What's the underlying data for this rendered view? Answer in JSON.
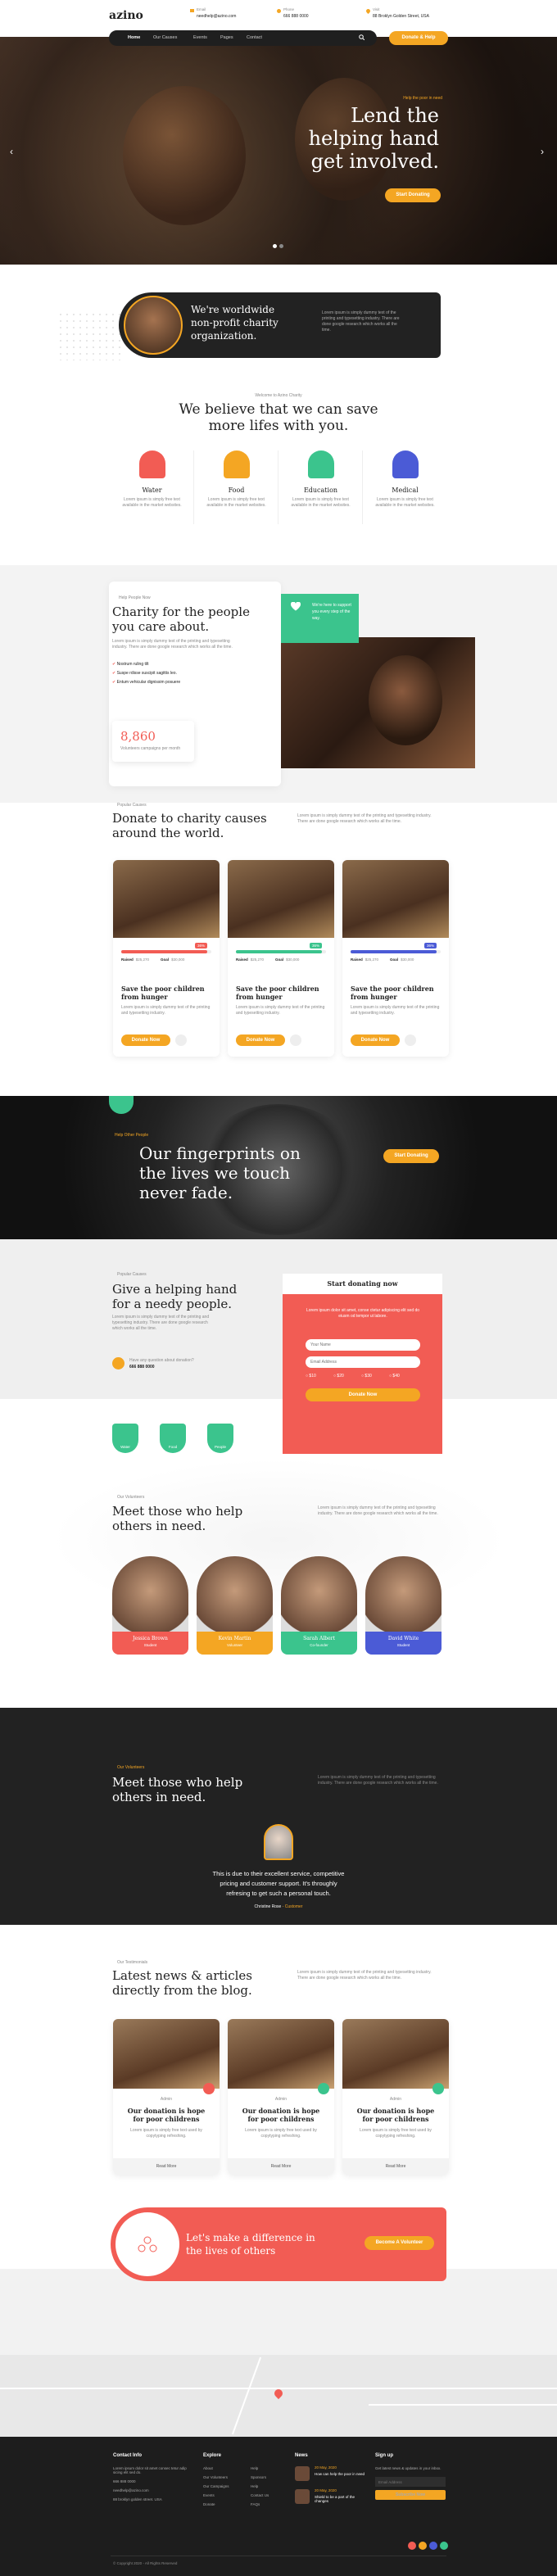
{
  "brand": {
    "logo": "azino"
  },
  "contact": {
    "email_label": "Email",
    "email": "needhelp@azino.com",
    "phone_label": "Phone",
    "phone": "666 888 0000",
    "visit_label": "Visit",
    "address": "88 Broklyn Golden Street, USA"
  },
  "nav": {
    "items": [
      "Home",
      "Our Causes",
      "Events",
      "Pages",
      "Contact"
    ],
    "cta": "Donate & Help"
  },
  "hero": {
    "tagline": "Help the poor in need",
    "title_lines": [
      "Lend the",
      "helping hand",
      "get involved."
    ],
    "button": "Start Donating"
  },
  "intro": {
    "title_lines": [
      "We're worldwide",
      "non-profit charity",
      "organization."
    ],
    "text": "Lorem ipsum is simply dummy text of the printing and typesetting industry. There are done google research which works all the time."
  },
  "welcome": {
    "tagline": "Welcome to Azino Charity",
    "title_lines": [
      "We believe that we can save",
      "more lifes with you."
    ],
    "features": [
      {
        "name": "Water",
        "text": "Lorem ipsum is simply free text available in the market websites.",
        "color": "#f25c54"
      },
      {
        "name": "Food",
        "text": "Lorem ipsum is simply free text available in the market websites.",
        "color": "#f4a623"
      },
      {
        "name": "Education",
        "text": "Lorem ipsum is simply free text available in the market websites.",
        "color": "#3bc48d"
      },
      {
        "name": "Medical",
        "text": "Lorem ipsum is simply free text available in the market websites.",
        "color": "#4b5bd6"
      }
    ]
  },
  "charity": {
    "tagline": "Help People Now",
    "title_lines": [
      "Charity for the people",
      "you care about."
    ],
    "text": "Lorem ipsum is simply dummy text of the printing and typesetting industry. There are done google research which works all the time.",
    "checks": [
      "Nostrum ruling tilt",
      "Suspe rdisse suscipit sagittis leo.",
      "Entum vehicular dignissim posuere"
    ],
    "counter": "8,860",
    "counter_label": "Volunteers campaigns per month",
    "support_text": "We're here to support you every step of the way."
  },
  "causes": {
    "tagline": "Popular Causes",
    "title_lines": [
      "Donate to charity causes",
      "around the world."
    ],
    "text": "Lorem ipsum is simply dummy text of the printing and typesetting industry. There are done google research which works all the time.",
    "items": [
      {
        "percent": "36%",
        "raised_label": "Raised",
        "raised": "$25,270",
        "goal_label": "Goal",
        "goal": "$30,000",
        "title": "Save the poor children from hunger",
        "text": "Lorem ipsum is simply dummy text of the printing and typesetting industry.",
        "button": "Donate Now",
        "color": "#f25c54"
      },
      {
        "percent": "36%",
        "raised_label": "Raised",
        "raised": "$25,270",
        "goal_label": "Goal",
        "goal": "$30,000",
        "title": "Save the poor children from hunger",
        "text": "Lorem ipsum is simply dummy text of the printing and typesetting industry.",
        "button": "Donate Now",
        "color": "#3bc48d"
      },
      {
        "percent": "36%",
        "raised_label": "Raised",
        "raised": "$25,270",
        "goal_label": "Goal",
        "goal": "$30,000",
        "title": "Save the poor children from hunger",
        "text": "Lorem ipsum is simply dummy text of the printing and typesetting industry.",
        "button": "Donate Now",
        "color": "#4b5bd6"
      }
    ]
  },
  "fingerprints": {
    "tagline": "Help Other People",
    "title_lines": [
      "Our fingerprints on",
      "the lives we touch",
      "never fade."
    ],
    "button": "Start Donating"
  },
  "helping": {
    "tagline": "Popular Causes",
    "title_lines": [
      "Give a helping hand",
      "for a needy people."
    ],
    "text": "Lorem ipsum is simply dummy text of the printing and typesetting industry. There are done google research which works all the time.",
    "question": "Have any question about donation?",
    "phone": "666 888 0000",
    "badges": [
      "Water",
      "Food",
      "People"
    ],
    "form_title": "Start donating now",
    "form_text": "Lorem ipsum dolor sit amet, conse ctetur adipiscing elit sed do eiusm od tempor ut labore.",
    "name_placeholder": "Your Name",
    "email_placeholder": "Email Address",
    "amounts": [
      "$10",
      "$20",
      "$30",
      "$40"
    ],
    "form_button": "Donate Now"
  },
  "volunteers": {
    "tagline": "Our Volunteers",
    "title_lines": [
      "Meet those who help",
      "others in need."
    ],
    "text": "Lorem ipsum is simply dummy text of the printing and typesetting industry. There are done google research which works all the time.",
    "people": [
      {
        "name": "Jessica Brown",
        "role": "Student",
        "color": "#f25c54"
      },
      {
        "name": "Kevin Martin",
        "role": "Volunteer",
        "color": "#f4a623"
      },
      {
        "name": "Sarah Albert",
        "role": "Co-founder",
        "color": "#3bc48d"
      },
      {
        "name": "David White",
        "role": "Student",
        "color": "#4b5bd6"
      }
    ]
  },
  "testimonial": {
    "tagline": "Our Volunteers",
    "title_lines": [
      "Meet those who help",
      "others in need."
    ],
    "text": "Lorem ipsum is simply dummy text of the printing and typesetting industry. There are done google research which works all the time.",
    "quote_lines": [
      "This is due to their excellent service, competitive",
      "pricing and customer support. It's throughly",
      "refresing to get such a personal touch."
    ],
    "author": "Christine Rose",
    "author_role": "Customer"
  },
  "news": {
    "tagline": "Our Testimonials",
    "title_lines": [
      "Latest news & articles",
      "directly from the blog."
    ],
    "text": "Lorem ipsum is simply dummy text of the printing and typesetting industry. There are done google research which works all the time.",
    "items": [
      {
        "author": "Admin",
        "title": "Our donation is hope for poor childrens",
        "text": "Lorem ipsum is simply free text used by copytyping refreshing.",
        "button": "Read More"
      },
      {
        "author": "Admin",
        "title": "Our donation is hope for poor childrens",
        "text": "Lorem ipsum is simply free text used by copytyping refreshing.",
        "button": "Read More"
      },
      {
        "author": "Admin",
        "title": "Our donation is hope for poor childrens",
        "text": "Lorem ipsum is simply free text used by copytyping refreshing.",
        "button": "Read More"
      }
    ]
  },
  "cta": {
    "title_lines": [
      "Let's make a difference in",
      "the lives of others"
    ],
    "button": "Become A Volunteer"
  },
  "footer": {
    "contact_title": "Contact Info",
    "contact_text": "Lorem ipsum dolor sit amet consec tetur adip sicing elit sed do.",
    "phone": "666 888 0000",
    "email": "needhelp@azino.com",
    "address": "88 broklyn golden street. USA",
    "explore_title": "Explore",
    "explore_col1": [
      "About",
      "Our Volunteers",
      "Our Campaigns",
      "Events",
      "Donate"
    ],
    "explore_col2": [
      "Help",
      "Sponsors",
      "Help",
      "Contact Us",
      "FAQs"
    ],
    "news_title": "News",
    "news_items": [
      {
        "date": "20 May, 2020",
        "title": "How can help the poor in need"
      },
      {
        "date": "20 May, 2020",
        "title": "Shield to be a part of the changes"
      }
    ],
    "signup_title": "Sign up",
    "signup_text": "Get latest news & updates in your inbox.",
    "email_placeholder": "Email Address",
    "subscribe": "Subscribe Now",
    "copyright": "© Copyright 2020 - All Rights Reserved"
  }
}
